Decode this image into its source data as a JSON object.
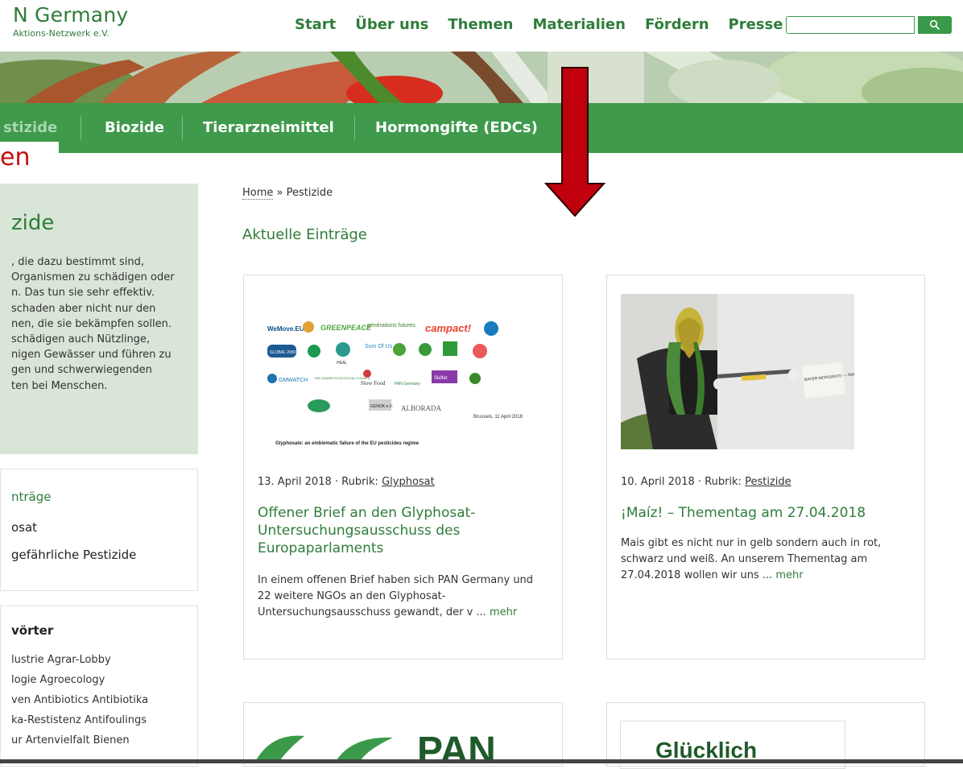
{
  "header": {
    "logo_title": "N Germany",
    "logo_sub": "Aktions-Netzwerk e.V.",
    "nav": [
      "Start",
      "Über uns",
      "Themen",
      "Materialien",
      "Fördern",
      "Presse"
    ],
    "search_placeholder": "",
    "search_icon": "magnifier-icon"
  },
  "subnav": {
    "items": [
      "stizide",
      "Biozide",
      "Tierarzneimittel",
      "Hormongifte (EDCs)"
    ]
  },
  "overlay_label": "en",
  "sidebar": {
    "title": "zide",
    "text": ", die dazu bestimmt sind,\nOrganismen zu schädigen oder\nn. Das tun sie sehr effektiv.\nschaden aber nicht nur den\nnen, die sie bekämpfen sollen.\nschädigen auch Nützlinge,\nnigen Gewässer und führen zu\ngen und schwerwiegenden\nten bei Menschen.",
    "entries_title": "nträge",
    "entries": [
      "osat",
      "gefährliche Pestizide"
    ],
    "tags_title": "vörter",
    "tags": [
      "lustrie Agrar-Lobby",
      "logie Agroecology",
      "ven Antibiotics Antibiotika",
      "ka-Restistenz Antifoulings",
      "ur Artenvielfalt Bienen"
    ]
  },
  "main": {
    "breadcrumb_home": "Home",
    "breadcrumb_sep": " » ",
    "breadcrumb_current": "Pestizide",
    "section_title": "Aktuelle Einträge",
    "cards": [
      {
        "meta_prefix": "13. April 2018 · Rubrik: ",
        "category": "Glyphosat",
        "title": "Offener Brief an den Glyphosat-Untersuchungsausschuss des Europaparlaments",
        "excerpt": "In einem offenen Brief haben sich PAN Germany und 22 weitere NGOs an den Glyphosat-Untersuchungsausschuss gewandt, der v ... ",
        "more": "mehr",
        "image_caption": "Glyphosate: an emblematic failure of the EU pesticides regime",
        "image_date": "Brussels, 11 April 2018",
        "image_logos": [
          "WeMove.EU",
          "GREENPEACE",
          "générations futures",
          "campact!",
          "GLOBAL 2000",
          "HEAL",
          "Sum Of Us",
          "GMWATCH",
          "THE DANISH ECOLOGICAL COUNCIL",
          "Slow Food",
          "PAN Germany",
          "Skiftet",
          "GENOK e.V.",
          "ALBORADA"
        ]
      },
      {
        "meta_prefix": "10. April 2018 · Rubrik: ",
        "category": "Pestizide",
        "title": "¡Maíz! – Thementag am 27.04.2018",
        "excerpt": "Mais gibt es nicht nur in gelb sondern auch in rot, schwarz und weiß. An unserem Thementag am 27.04.2018 wollen wir uns ... ",
        "more": "mehr",
        "image_sign": "BAYER-MONSANTO — RAUS VOM ACKER"
      }
    ],
    "bottom_card_right_text": "Glücklich",
    "bottom_card_left_text": "PAN"
  },
  "colors": {
    "brand_green": "#2f7d3a",
    "nav_bar_green": "#3f9a4c",
    "sidebar_bg": "#d9e5d7",
    "arrow_red": "#c0000c"
  }
}
